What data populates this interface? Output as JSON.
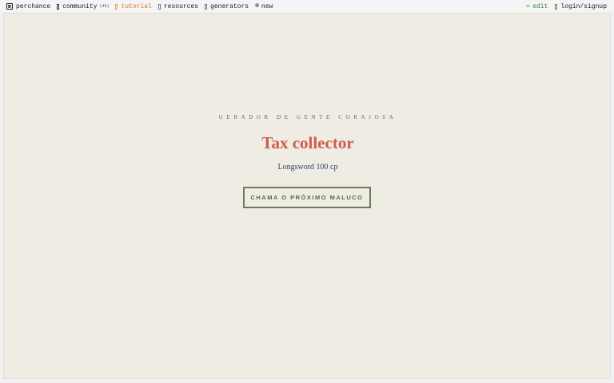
{
  "nav": {
    "logo_label": "perchance",
    "community_label": "community",
    "community_count": "(4h)",
    "tutorial_label": "tutorial",
    "resources_label": "resources",
    "generators_label": "generators",
    "new_label": "new",
    "edit_label": "edit",
    "login_label": "login/signup",
    "tutorial_color": "#e07b1f",
    "edit_color": "#2c8f2c"
  },
  "main": {
    "subtitle": "GERADOR DE GENTE CORAJOSA",
    "title": "Tax collector",
    "detail": "Longsword 100 cp",
    "button_label": "CHAMA O PRÓXIMO MALUCO",
    "title_color": "#d25a4c",
    "background_color": "#efede3"
  }
}
